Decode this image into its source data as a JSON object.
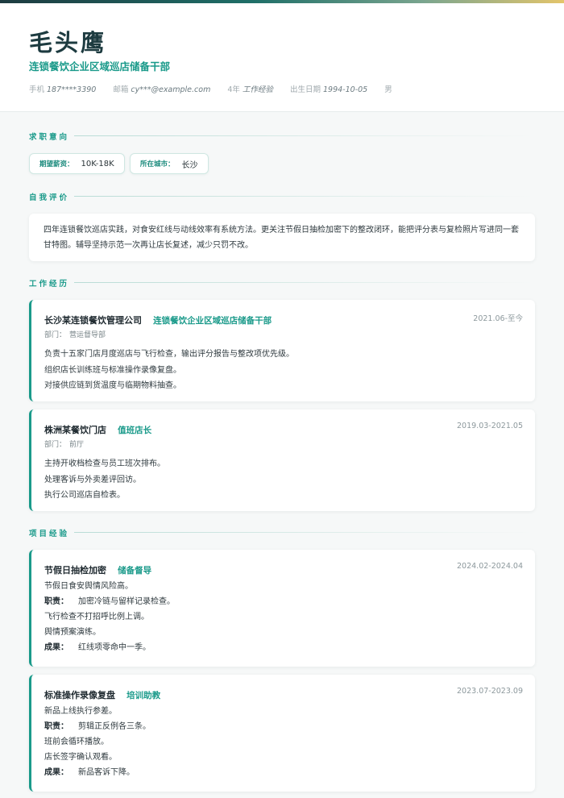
{
  "profile": {
    "name": "毛头鹰",
    "target_role": "连锁餐饮企业区域巡店储备干部",
    "phone_label": "手机",
    "phone": "187****3390",
    "email_label": "邮箱",
    "email": "cy***@example.com",
    "years_label": "4年",
    "years_value": "工作经验",
    "birth_label": "出生日期",
    "birth": "1994-10-05",
    "gender": "男"
  },
  "sections": {
    "intent": "求职意向",
    "summary": "自我评价",
    "work": "工作经历",
    "projects": "项目经验"
  },
  "intent": {
    "salary_label": "期望薪资：",
    "salary": "10K-18K",
    "city_label": "所在城市：",
    "city": "长沙"
  },
  "summary_text": "四年连锁餐饮巡店实践，对食安红线与动线效率有系统方法。更关注节假日抽检加密下的整改闭环，能把评分表与复检照片写进同一套甘特图。辅导坚持示范一次再让店长复述，减少只罚不改。",
  "work": [
    {
      "company": "长沙某连锁餐饮管理公司",
      "position": "连锁餐饮企业区域巡店储备干部",
      "date": "2021.06-至今",
      "dept_label": "部门：",
      "dept": "营运督导部",
      "lines": [
        "负责十五家门店月度巡店与飞行检查，输出评分报告与整改项优先级。",
        "组织店长训练班与标准操作录像复盘。",
        "对接供应链到货温度与临期物料抽查。"
      ]
    },
    {
      "company": "株洲某餐饮门店",
      "position": "值班店长",
      "date": "2019.03-2021.05",
      "dept_label": "部门：",
      "dept": "前厅",
      "lines": [
        "主持开收档检查与员工班次排布。",
        "处理客诉与外卖差评回访。",
        "执行公司巡店自检表。"
      ]
    }
  ],
  "projects": [
    {
      "name": "节假日抽检加密",
      "role": "储备督导",
      "date": "2024.02-2024.04",
      "desc": "节假日食安舆情风险高。",
      "duty_label": "职责：",
      "duties": [
        "加密冷链与留样记录检查。",
        "飞行检查不打招呼比例上调。",
        "舆情预案演练。"
      ],
      "result_label": "成果：",
      "result": "红线项零命中一季。"
    },
    {
      "name": "标准操作录像复盘",
      "role": "培训助教",
      "date": "2023.07-2023.09",
      "desc": "新品上线执行参差。",
      "duty_label": "职责：",
      "duties": [
        "剪辑正反例各三条。",
        "班前会循环播放。",
        "店长签字确认观看。"
      ],
      "result_label": "成果：",
      "result": "新品客诉下降。"
    }
  ]
}
